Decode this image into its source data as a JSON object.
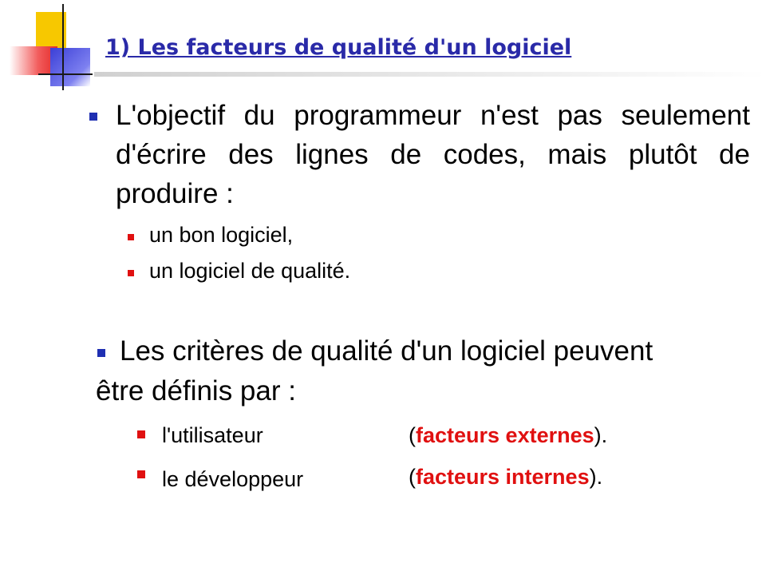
{
  "title": "1)  Les facteurs de qualité d'un logiciel",
  "point1": {
    "text": "L'objectif du programmeur n'est pas seulement d'écrire des lignes de codes, mais plutôt de produire :",
    "subitems": [
      "un bon logiciel,",
      "un logiciel de qualité."
    ]
  },
  "point2": {
    "text": "Les critères de qualité d'un logiciel peuvent être définis par :",
    "rows": [
      {
        "actor": "l'utilisateur",
        "open": "(",
        "factor": "facteurs externes",
        "close": ")."
      },
      {
        "actor": "le développeur",
        "open": "(",
        "factor": "facteurs internes",
        "close": ")."
      }
    ]
  },
  "colors": {
    "title": "#2a2aa8",
    "bullet_level1": "#1f2fb2",
    "bullet_level2": "#e01010",
    "highlight": "#e01010"
  }
}
